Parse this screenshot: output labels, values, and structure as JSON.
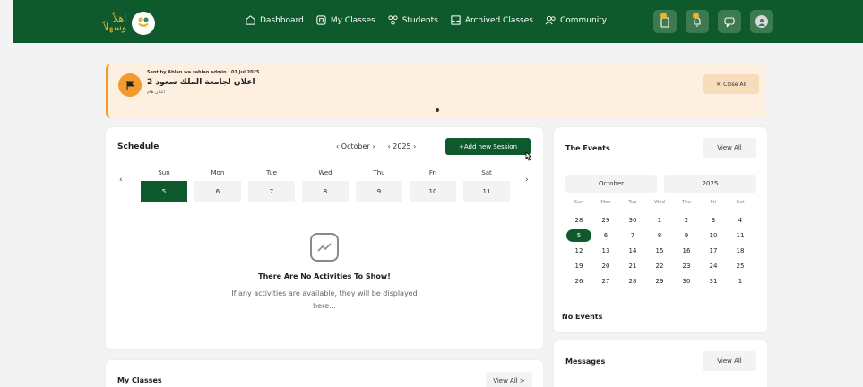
{
  "brand": {
    "logo_text_line1": "اهلاً",
    "logo_text_line2": "وسهلاً"
  },
  "nav": [
    {
      "label": "Dashboard",
      "icon": "home-icon"
    },
    {
      "label": "My Classes",
      "icon": "class-icon"
    },
    {
      "label": "Students",
      "icon": "students-icon"
    },
    {
      "label": "Archived Classes",
      "icon": "archive-icon"
    },
    {
      "label": "Community",
      "icon": "community-icon"
    }
  ],
  "announcement": {
    "sender": "Sent by Ahlan wa sahlan admin : 01 Jul 2025",
    "title": "اعلان لجامعة الملك سعود 2",
    "subtitle": "اعلان هام",
    "close_label": "Close All"
  },
  "schedule": {
    "title": "Schedule",
    "month": "October",
    "year": "2025",
    "add_label": "+Add new Session",
    "days": [
      {
        "name": "Sun",
        "num": "5"
      },
      {
        "name": "Mon",
        "num": "6"
      },
      {
        "name": "Tue",
        "num": "7"
      },
      {
        "name": "Wed",
        "num": "8"
      },
      {
        "name": "Thu",
        "num": "9"
      },
      {
        "name": "Fri",
        "num": "10"
      },
      {
        "name": "Sat",
        "num": "11"
      }
    ],
    "empty_title": "There Are No Activities To Show!",
    "empty_sub": "If any activities are available, they will be displayed here..."
  },
  "events": {
    "title": "The Events",
    "view_all": "View All",
    "month": "October",
    "year": "2025",
    "weekdays": [
      "Sun",
      "Mon",
      "Tue",
      "Wed",
      "Thu",
      "Fri",
      "Sat"
    ],
    "weeks": [
      [
        "28",
        "29",
        "30",
        "1",
        "2",
        "3",
        "4"
      ],
      [
        "5",
        "6",
        "7",
        "8",
        "9",
        "10",
        "11"
      ],
      [
        "12",
        "13",
        "14",
        "15",
        "16",
        "17",
        "18"
      ],
      [
        "19",
        "20",
        "21",
        "22",
        "23",
        "24",
        "25"
      ],
      [
        "26",
        "27",
        "28",
        "29",
        "30",
        "31",
        "1"
      ]
    ],
    "no_events": "No Events"
  },
  "messages": {
    "title": "Messages",
    "view_all": "View All"
  },
  "my_classes": {
    "title": "My Classes",
    "view_all": "View All >"
  },
  "colors": {
    "primary": "#0f5a2c",
    "accent": "#f0b429",
    "banner": "#fdf0e1",
    "banner_border": "#f29a2e"
  }
}
